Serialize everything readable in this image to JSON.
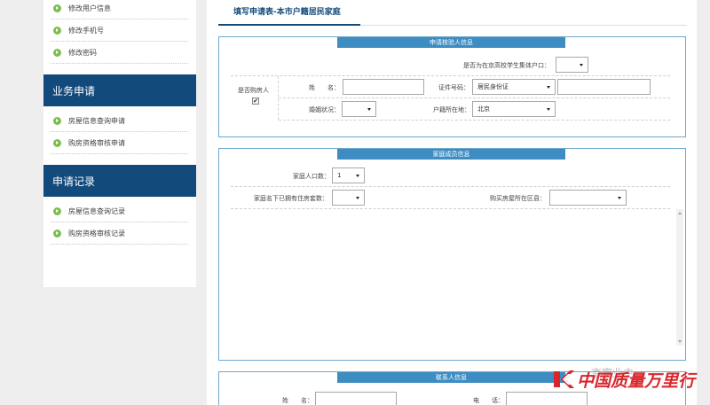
{
  "sidebar": {
    "top_items": [
      {
        "label": "修改用户信息"
      },
      {
        "label": "修改手机号"
      },
      {
        "label": "修改密码"
      }
    ],
    "sections": [
      {
        "heading": "业务申请",
        "items": [
          {
            "label": "房屋信息查询申请"
          },
          {
            "label": "购房资格审核申请"
          }
        ]
      },
      {
        "heading": "申请记录",
        "items": [
          {
            "label": "房屋信息查询记录"
          },
          {
            "label": "购房资格审核记录"
          }
        ]
      }
    ]
  },
  "form": {
    "title": "填写申请表-本市户籍居民家庭",
    "applicant": {
      "heading": "申请核验人信息",
      "student_question": "是否为在京高校学生集体户口：",
      "student_value": "",
      "is_buyer_label": "是否购房人",
      "is_buyer_checked": "✔",
      "name_label": "姓　　名：",
      "name_value": "",
      "id_type_label": "证件号码：",
      "id_type_value": "居民身份证",
      "id_number_value": "",
      "marital_label": "婚姻状况：",
      "marital_value": "",
      "hukou_label": "户籍所在地：",
      "hukou_value": "北京"
    },
    "family": {
      "heading": "家庭成员信息",
      "population_label": "家庭人口数：",
      "population_value": "1",
      "owned_label": "家庭名下已拥有住房套数：",
      "owned_value": "",
      "district_label": "购买房屋所在区县：",
      "district_value": ""
    },
    "contact": {
      "heading": "联系人信息",
      "name_label": "姓　　名：",
      "name_value": "",
      "phone_label": "电　　话：",
      "phone_value": ""
    }
  },
  "watermark": {
    "small_text": "京室业主",
    "logo_text": "中国质量万里行"
  },
  "colors": {
    "sidebar_heading_bg": "#124a7c",
    "panel_head_bg": "#3e8dc2",
    "bullet_green": "#7cbf4c",
    "logo_red": "#d9262c"
  }
}
